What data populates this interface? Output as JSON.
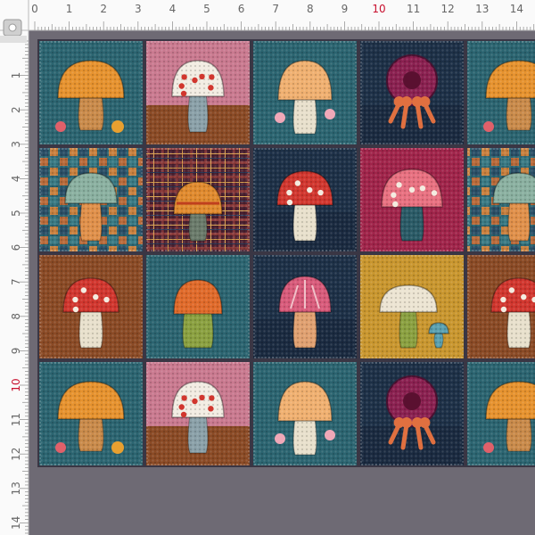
{
  "ruler": {
    "top_labels": [
      "0",
      "1",
      "2",
      "3",
      "4",
      "5",
      "6",
      "7",
      "8",
      "9",
      "10",
      "11",
      "12",
      "13",
      "14"
    ],
    "left_labels": [
      "1",
      "2",
      "3",
      "4",
      "5",
      "6",
      "7",
      "8",
      "9",
      "10",
      "11",
      "12",
      "13",
      "14"
    ],
    "highlight_label": "10",
    "label_color": "#666666",
    "highlight_color": "#c8102e"
  },
  "palette": {
    "teal": "#2b6470",
    "teal_dark": "#1f4e5a",
    "navy": "#1d3047",
    "pink": "#c9798f",
    "rust": "#8a4a25",
    "magenta": "#a0244a",
    "mustard": "#c9962e",
    "plaid": "#5a2a3a",
    "seam": "#6e6a74",
    "orange": "#e6922e",
    "red": "#d1362e",
    "cream": "#ece4d2",
    "sage": "#8ab0a0",
    "peach": "#f0b070"
  },
  "tiles": [
    {
      "bg": "teal",
      "motif": "orange-mushroom"
    },
    {
      "bg": "pink",
      "motif": "spotted-white-mushroom"
    },
    {
      "bg": "teal",
      "motif": "peach-mushroom"
    },
    {
      "bg": "navy",
      "motif": "purple-flower"
    },
    {
      "bg": "teal",
      "motif": "orange-mushroom"
    },
    {
      "bg": "patchwork",
      "motif": "sage-mushroom"
    },
    {
      "bg": "plaid",
      "motif": "orange-striped-mushroom"
    },
    {
      "bg": "navy",
      "motif": "red-spotted-mushroom"
    },
    {
      "bg": "magenta",
      "motif": "pink-spotted-mushroom"
    },
    {
      "bg": "patchwork",
      "motif": "sage-mushroom"
    },
    {
      "bg": "rust",
      "motif": "red-spotted-mushroom"
    },
    {
      "bg": "teal",
      "motif": "orange-green-mushroom"
    },
    {
      "bg": "navy",
      "motif": "pink-striped-mushroom"
    },
    {
      "bg": "mustard",
      "motif": "cream-mushroom"
    },
    {
      "bg": "rust",
      "motif": "red-spotted-mushroom"
    },
    {
      "bg": "teal",
      "motif": "orange-mushroom"
    },
    {
      "bg": "pink",
      "motif": "spotted-white-mushroom"
    },
    {
      "bg": "teal",
      "motif": "peach-mushroom"
    },
    {
      "bg": "navy",
      "motif": "purple-flower"
    },
    {
      "bg": "teal",
      "motif": "orange-mushroom"
    }
  ]
}
